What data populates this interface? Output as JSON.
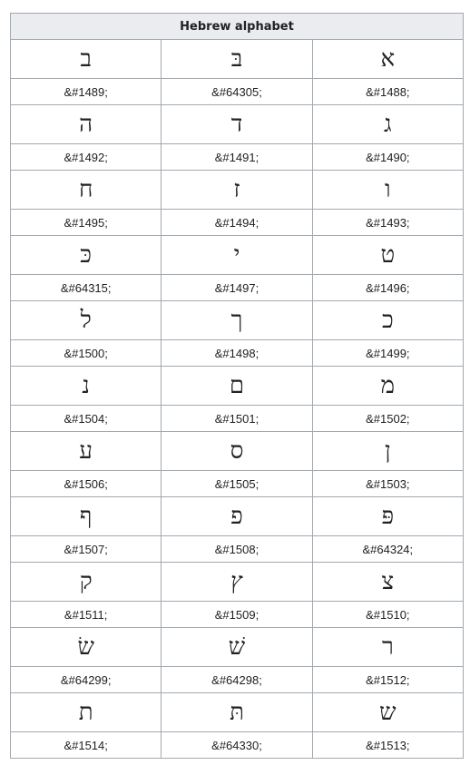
{
  "table": {
    "title": "Hebrew alphabet",
    "rows": [
      [
        {
          "glyph": "ב",
          "code": "&#1489;"
        },
        {
          "glyph": "בּ",
          "code": "&#64305;"
        },
        {
          "glyph": "א",
          "code": "&#1488;"
        }
      ],
      [
        {
          "glyph": "ה",
          "code": "&#1492;"
        },
        {
          "glyph": "ד",
          "code": "&#1491;"
        },
        {
          "glyph": "ג",
          "code": "&#1490;"
        }
      ],
      [
        {
          "glyph": "ח",
          "code": "&#1495;"
        },
        {
          "glyph": "ז",
          "code": "&#1494;"
        },
        {
          "glyph": "ו",
          "code": "&#1493;"
        }
      ],
      [
        {
          "glyph": "כּ",
          "code": "&#64315;"
        },
        {
          "glyph": "י",
          "code": "&#1497;"
        },
        {
          "glyph": "ט",
          "code": "&#1496;"
        }
      ],
      [
        {
          "glyph": "ל",
          "code": "&#1500;"
        },
        {
          "glyph": "ך",
          "code": "&#1498;"
        },
        {
          "glyph": "כ",
          "code": "&#1499;"
        }
      ],
      [
        {
          "glyph": "נ",
          "code": "&#1504;"
        },
        {
          "glyph": "ם",
          "code": "&#1501;"
        },
        {
          "glyph": "מ",
          "code": "&#1502;"
        }
      ],
      [
        {
          "glyph": "ע",
          "code": "&#1506;"
        },
        {
          "glyph": "ס",
          "code": "&#1505;"
        },
        {
          "glyph": "ן",
          "code": "&#1503;"
        }
      ],
      [
        {
          "glyph": "ף",
          "code": "&#1507;"
        },
        {
          "glyph": "פ",
          "code": "&#1508;"
        },
        {
          "glyph": "פּ",
          "code": "&#64324;"
        }
      ],
      [
        {
          "glyph": "ק",
          "code": "&#1511;"
        },
        {
          "glyph": "ץ",
          "code": "&#1509;"
        },
        {
          "glyph": "צ",
          "code": "&#1510;"
        }
      ],
      [
        {
          "glyph": "שׂ",
          "code": "&#64299;"
        },
        {
          "glyph": "שׁ",
          "code": "&#64298;"
        },
        {
          "glyph": "ר",
          "code": "&#1512;"
        }
      ],
      [
        {
          "glyph": "ת",
          "code": "&#1514;"
        },
        {
          "glyph": "תּ",
          "code": "&#64330;"
        },
        {
          "glyph": "ש",
          "code": "&#1513;"
        }
      ]
    ]
  }
}
